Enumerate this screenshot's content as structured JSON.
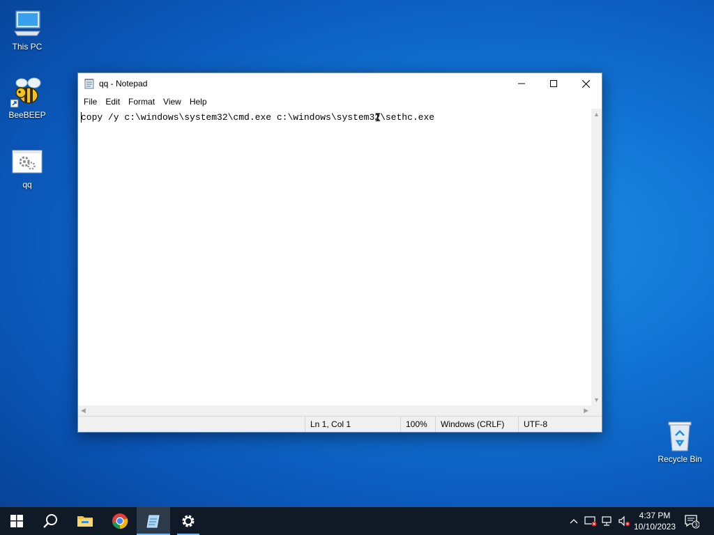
{
  "desktop": {
    "icons": [
      {
        "label": "This PC",
        "icon": "computer-icon"
      },
      {
        "label": "BeeBEEP",
        "icon": "bee-icon"
      },
      {
        "label": "qq",
        "icon": "settings-file-icon"
      },
      {
        "label": "Recycle Bin",
        "icon": "recycle-bin-icon"
      }
    ]
  },
  "notepad": {
    "title": "qq - Notepad",
    "menu": [
      "File",
      "Edit",
      "Format",
      "View",
      "Help"
    ],
    "content": "copy /y c:\\windows\\system32\\cmd.exe c:\\windows\\system32\\sethc.exe",
    "status": {
      "position": "Ln 1, Col 1",
      "zoom": "100%",
      "line_ending": "Windows (CRLF)",
      "encoding": "UTF-8"
    }
  },
  "taskbar": {
    "apps": [
      "start-icon",
      "search-icon",
      "file-explorer-icon",
      "chrome-icon",
      "notepad-icon",
      "settings-icon"
    ],
    "clock": {
      "time": "4:37 PM",
      "date": "10/10/2023"
    },
    "notifications_count": "3"
  },
  "colors": {
    "taskbar": "#101a26",
    "accent": "#7fb6ea",
    "desktop": "#1173d4"
  }
}
